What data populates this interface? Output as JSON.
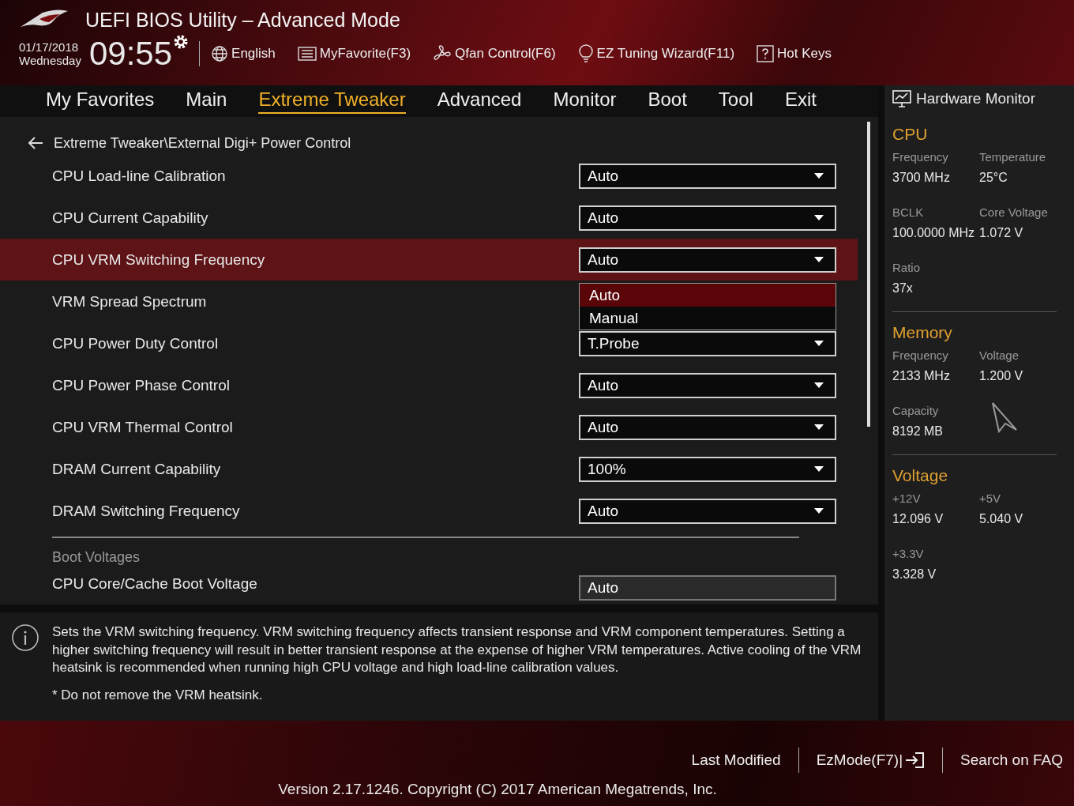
{
  "header": {
    "title": "UEFI BIOS Utility – Advanced Mode",
    "date": "01/17/2018",
    "day": "Wednesday",
    "time": "09:55",
    "tools": [
      {
        "kind": "globe",
        "label": "English"
      },
      {
        "kind": "list",
        "label": "MyFavorite(F3)"
      },
      {
        "kind": "fan",
        "label": "Qfan Control(F6)"
      },
      {
        "kind": "bulb",
        "label": "EZ Tuning Wizard(F11)"
      },
      {
        "kind": "help",
        "label": "Hot Keys"
      }
    ]
  },
  "tabs": [
    {
      "label": "My Favorites",
      "selected": false
    },
    {
      "label": "Main",
      "selected": false
    },
    {
      "label": "Extreme Tweaker",
      "selected": true
    },
    {
      "label": "Advanced",
      "selected": false
    },
    {
      "label": "Monitor",
      "selected": false
    },
    {
      "label": "Boot",
      "selected": false
    },
    {
      "label": "Tool",
      "selected": false
    },
    {
      "label": "Exit",
      "selected": false
    }
  ],
  "breadcrumb": "Extreme Tweaker\\External Digi+ Power Control",
  "settings": [
    {
      "label": "CPU Load-line Calibration",
      "value": "Auto",
      "selected": false
    },
    {
      "label": "CPU Current Capability",
      "value": "Auto",
      "selected": false
    },
    {
      "label": "CPU VRM Switching Frequency",
      "value": "Auto",
      "selected": true,
      "options": [
        {
          "label": "Auto",
          "selected": true
        },
        {
          "label": "Manual",
          "selected": false
        }
      ]
    },
    {
      "label": "VRM Spread Spectrum",
      "selected": false
    },
    {
      "label": "CPU Power Duty Control",
      "value": "T.Probe",
      "selected": false
    },
    {
      "label": "CPU Power Phase Control",
      "value": "Auto",
      "selected": false
    },
    {
      "label": "CPU VRM Thermal Control",
      "value": "Auto",
      "selected": false
    },
    {
      "label": "DRAM Current Capability",
      "value": "100%",
      "selected": false
    },
    {
      "label": "DRAM Switching Frequency",
      "value": "Auto",
      "selected": false
    }
  ],
  "section": "Boot Voltages",
  "cut_row": {
    "label": "CPU Core/Cache Boot Voltage",
    "value": "Auto"
  },
  "help": {
    "text": "Sets the VRM switching frequency.  VRM switching frequency affects transient response and VRM component temperatures. Setting a higher switching frequency will result in better transient response at the expense of higher VRM temperatures. Active cooling of the VRM heatsink is recommended when running high CPU voltage and high load-line calibration values.",
    "note": "* Do not remove the VRM heatsink."
  },
  "monitor": {
    "title": "Hardware Monitor",
    "sections": [
      {
        "title": "CPU",
        "items": [
          {
            "label": "Frequency",
            "value": "3700 MHz"
          },
          {
            "label": "Temperature",
            "value": "25°C"
          },
          {
            "label": "BCLK",
            "value": "100.0000 MHz"
          },
          {
            "label": "Core Voltage",
            "value": "1.072 V"
          },
          {
            "label": "Ratio",
            "value": "37x"
          }
        ]
      },
      {
        "title": "Memory",
        "items": [
          {
            "label": "Frequency",
            "value": "2133 MHz"
          },
          {
            "label": "Voltage",
            "value": "1.200 V"
          },
          {
            "label": "Capacity",
            "value": "8192 MB"
          }
        ]
      },
      {
        "title": "Voltage",
        "items": [
          {
            "label": "+12V",
            "value": "12.096 V"
          },
          {
            "label": "+5V",
            "value": "5.040 V"
          },
          {
            "label": "+3.3V",
            "value": "3.328 V"
          }
        ]
      }
    ]
  },
  "footer": {
    "links": [
      "Last Modified",
      "EzMode(F7)|",
      "Search on FAQ"
    ],
    "version": "Version 2.17.1246. Copyright (C) 2017 American Megatrends, Inc."
  }
}
